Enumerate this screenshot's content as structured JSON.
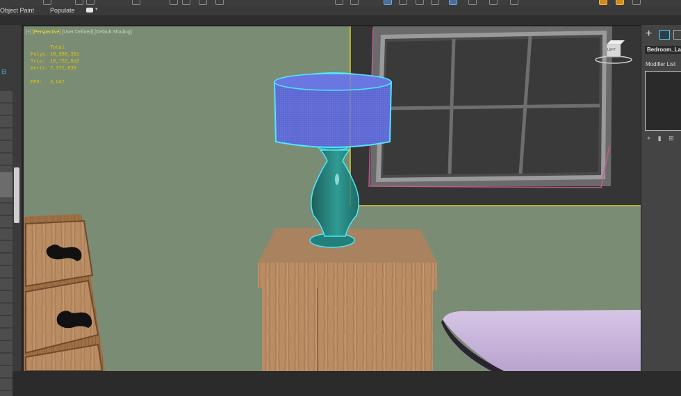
{
  "ribbon": {
    "object_paint": "Object Paint",
    "populate": "Populate"
  },
  "viewport": {
    "label_plus": "[+]",
    "label_view": "[Perspective]",
    "label_user": "[User Defined]",
    "label_shading": "[Default Shading]",
    "stats_header": "Total",
    "polys_label": "Polys:",
    "polys_value": "10,088,301",
    "tris_label": "Tris:",
    "tris_value": "10,752,818",
    "verts_label": "Verts:",
    "verts_value": "7,372,830",
    "fps_label": "FPS:",
    "fps_value": "3,647",
    "viewcube_label": "LEFT"
  },
  "command_panel": {
    "object_name": "Bedroom_Lamp",
    "modifier_list_label": "Modifier List"
  },
  "colors": {
    "accent_selection": "#4ee8ff",
    "viewport_bg": "#7a8c73",
    "stats_text": "#e6c700",
    "active_view_label": "#ffe135"
  },
  "icons": [
    "create-icon",
    "modify-icon",
    "pin-stack-icon",
    "show-end-result-icon",
    "viewcube-icon"
  ]
}
